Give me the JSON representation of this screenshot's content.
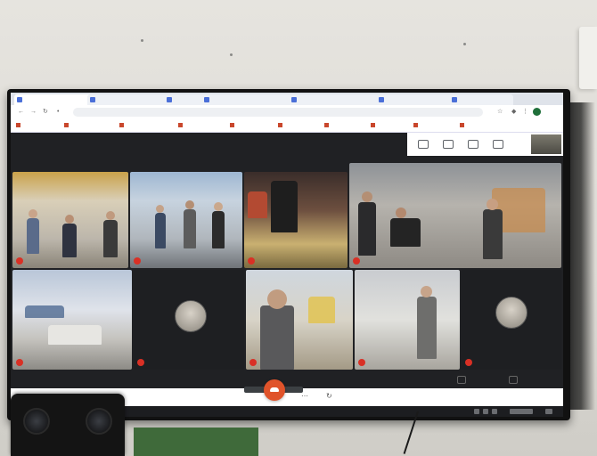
{
  "browser": {
    "tabs": [
      "",
      "",
      "",
      "",
      "",
      "",
      ""
    ],
    "url": "",
    "bookmarks": [
      "",
      "",
      "",
      "",
      "",
      "",
      "",
      "",
      "",
      ""
    ]
  },
  "meet": {
    "participants": [
      {
        "name": ""
      },
      {
        "name": ""
      },
      {
        "name": ""
      },
      {
        "name": ""
      },
      {
        "name": ""
      },
      {
        "name": ""
      },
      {
        "name": ""
      },
      {
        "name": ""
      },
      {
        "name": ""
      }
    ],
    "meeting_code": "",
    "side_controls": [
      "",
      ""
    ]
  },
  "colors": {
    "end_call": "#e0532a",
    "mic_off": "#d93025",
    "meet_bg": "#202124"
  },
  "icons": [
    "end-call-icon",
    "mic-off-icon",
    "people-icon",
    "chat-icon",
    "activities-icon",
    "info-icon"
  ]
}
